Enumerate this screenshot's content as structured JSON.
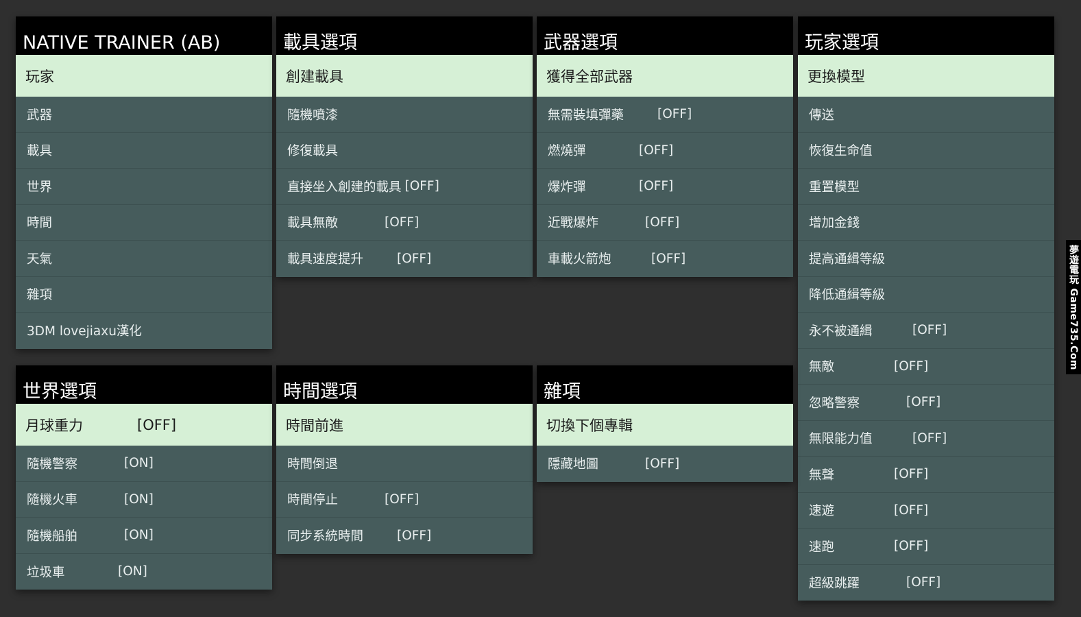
{
  "main_menu": {
    "title": "NATIVE  TRAINER  (AB)",
    "items": [
      {
        "label": "玩家"
      },
      {
        "label": "武器"
      },
      {
        "label": "載具"
      },
      {
        "label": "世界"
      },
      {
        "label": "時間"
      },
      {
        "label": "天氣"
      },
      {
        "label": "雜項"
      },
      {
        "label": "3DM lovejiaxu漢化"
      }
    ]
  },
  "vehicle_options": {
    "title": "載具選項",
    "items": [
      {
        "label": "創建載具"
      },
      {
        "label": "隨機噴漆"
      },
      {
        "label": "修復載具"
      },
      {
        "label": "直接坐入創建的載具",
        "state": "[OFF]"
      },
      {
        "label": "載具無敵",
        "state": "[OFF]"
      },
      {
        "label": "載具速度提升",
        "state": "[OFF]"
      }
    ]
  },
  "weapon_options": {
    "title": "武器選項",
    "items": [
      {
        "label": "獲得全部武器"
      },
      {
        "label": "無需裝填彈藥",
        "state": "[OFF]"
      },
      {
        "label": "燃燒彈",
        "state": "[OFF]"
      },
      {
        "label": "爆炸彈",
        "state": "[OFF]"
      },
      {
        "label": "近戰爆炸",
        "state": "[OFF]"
      },
      {
        "label": "車載火箭炮",
        "state": "[OFF]"
      }
    ]
  },
  "player_options": {
    "title": "玩家選項",
    "items": [
      {
        "label": "更換模型"
      },
      {
        "label": "傳送"
      },
      {
        "label": "恢復生命值"
      },
      {
        "label": "重置模型"
      },
      {
        "label": "增加金錢"
      },
      {
        "label": "提高通緝等級"
      },
      {
        "label": "降低通緝等級"
      },
      {
        "label": "永不被通緝",
        "state": "[OFF]"
      },
      {
        "label": "無敵",
        "state": "[OFF]"
      },
      {
        "label": "忽略警察",
        "state": "[OFF]"
      },
      {
        "label": "無限能力值",
        "state": "[OFF]"
      },
      {
        "label": "無聲",
        "state": "[OFF]"
      },
      {
        "label": "速遊",
        "state": "[OFF]"
      },
      {
        "label": "速跑",
        "state": "[OFF]"
      },
      {
        "label": "超級跳躍",
        "state": "[OFF]"
      }
    ]
  },
  "world_options": {
    "title": "世界選項",
    "items": [
      {
        "label": "月球重力",
        "state": "[OFF]"
      },
      {
        "label": "隨機警察",
        "state": "[ON]"
      },
      {
        "label": "隨機火車",
        "state": "[ON]"
      },
      {
        "label": "隨機船舶",
        "state": "[ON]"
      },
      {
        "label": "垃圾車",
        "state": "[ON]"
      }
    ]
  },
  "time_options": {
    "title": "時間選項",
    "items": [
      {
        "label": "時間前進"
      },
      {
        "label": "時間倒退"
      },
      {
        "label": "時間停止",
        "state": "[OFF]"
      },
      {
        "label": "同步系統時間",
        "state": "[OFF]"
      }
    ]
  },
  "misc_options": {
    "title": "雜項",
    "items": [
      {
        "label": "切換下個專輯"
      },
      {
        "label": "隱藏地圖",
        "state": "[OFF]"
      }
    ]
  },
  "watermark": {
    "text": "夢遊電玩 Game735.Com"
  },
  "colors": {
    "background": "#2f2f2f",
    "header": "#000000",
    "item": "#465c5c",
    "selected": "#d6f0d6"
  }
}
